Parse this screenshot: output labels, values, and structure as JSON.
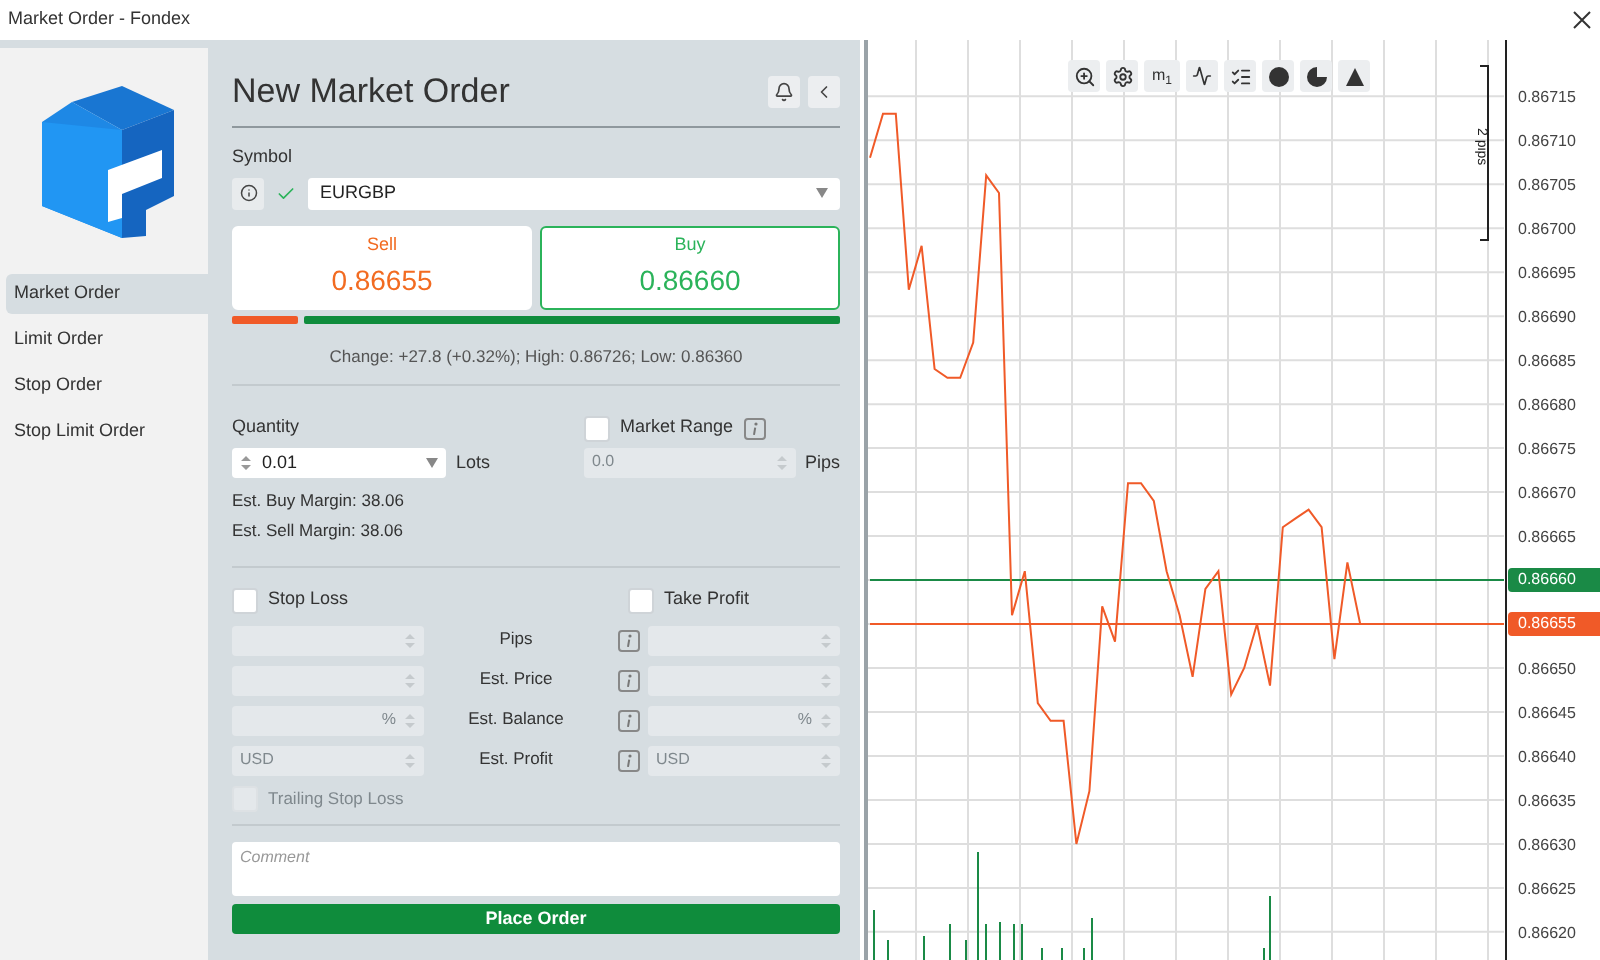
{
  "window": {
    "title": "Market Order - Fondex"
  },
  "sidebar": {
    "items": [
      {
        "label": "Market Order",
        "selected": true
      },
      {
        "label": "Limit Order",
        "selected": false
      },
      {
        "label": "Stop Order",
        "selected": false
      },
      {
        "label": "Stop Limit Order",
        "selected": false
      }
    ]
  },
  "form": {
    "title": "New Market Order",
    "symbol_label": "Symbol",
    "symbol_valid": true,
    "symbol": "EURGBP",
    "sell": {
      "label": "Sell",
      "price": "0.86655",
      "selected": false
    },
    "buy": {
      "label": "Buy",
      "price": "0.86660",
      "selected": true
    },
    "sentiment_bar": {
      "level": 0.11
    },
    "stats": "Change: +27.8 (+0.32%); High: 0.86726; Low: 0.86360",
    "quantity_label": "Quantity",
    "quantity": "0.01",
    "quantity_unit": "Lots",
    "margins": [
      "Est. Buy Margin: 38.06",
      "Est. Sell Margin: 38.06"
    ],
    "market_range": {
      "label": "Market Range",
      "checked": false,
      "placeholder": "0.0",
      "unit": "Pips",
      "disabled": true
    },
    "stop_loss": {
      "label": "Stop Loss",
      "checked": false
    },
    "take_profit": {
      "label": "Take Profit",
      "checked": false
    },
    "protection_rows": [
      {
        "label": "Pips",
        "sl": {},
        "tp": {}
      },
      {
        "label": "Est. Price",
        "sl": {},
        "tp": {}
      },
      {
        "label": "Est. Balance",
        "sl": {
          "unit": "%"
        },
        "tp": {
          "unit": "%"
        }
      },
      {
        "label": "Est. Profit",
        "sl": {
          "placeholder": "USD"
        },
        "tp": {
          "placeholder": "USD"
        }
      }
    ],
    "trailing_stop_loss": {
      "label": "Trailing Stop Loss",
      "checked": false,
      "disabled": true
    },
    "comment": {
      "placeholder": "Comment"
    },
    "place_order": "Place Order"
  },
  "chart": {
    "timeframe": "m$_{1}$",
    "range_label": "2 pips",
    "chart_data": {
      "type": "line",
      "grid": true,
      "ylim": [
        0.866168,
        0.867214
      ],
      "yticks": [
        {
          "value": 0.86715,
          "label": "0.86715"
        },
        {
          "value": 0.8671,
          "label": "0.86710"
        },
        {
          "value": 0.86705,
          "label": "0.86705"
        },
        {
          "value": 0.867,
          "label": "0.86700"
        },
        {
          "value": 0.86695,
          "label": "0.86695"
        },
        {
          "value": 0.8669,
          "label": "0.86690"
        },
        {
          "value": 0.86685,
          "label": "0.86685"
        },
        {
          "value": 0.8668,
          "label": "0.86680"
        },
        {
          "value": 0.86675,
          "label": "0.86675"
        },
        {
          "value": 0.8667,
          "label": "0.86670"
        },
        {
          "value": 0.86665,
          "label": "0.86665"
        },
        {
          "value": 0.8666,
          "label": "0.86660"
        },
        {
          "value": 0.86655,
          "label": "0.86655"
        },
        {
          "value": 0.8665,
          "label": "0.86650"
        },
        {
          "value": 0.86645,
          "label": "0.86645"
        },
        {
          "value": 0.8664,
          "label": "0.86640"
        },
        {
          "value": 0.86635,
          "label": "0.86635"
        },
        {
          "value": 0.8663,
          "label": "0.86630"
        },
        {
          "value": 0.86625,
          "label": "0.86625"
        },
        {
          "value": 0.8662,
          "label": "0.86620"
        }
      ],
      "series": [
        {
          "color": "#f05a28",
          "values": [
            0.86708,
            0.86713,
            0.86713,
            0.86693,
            0.86698,
            0.86684,
            0.86683,
            0.86683,
            0.86687,
            0.86706,
            0.86704,
            0.86656,
            0.86661,
            0.86646,
            0.86644,
            0.86644,
            0.8663,
            0.86636,
            0.86657,
            0.86653,
            0.86671,
            0.86671,
            0.86669,
            0.86661,
            0.86656,
            0.86649,
            0.86659,
            0.86661,
            0.86647,
            0.8665,
            0.86655,
            0.86648,
            0.86666,
            0.86667,
            0.86668,
            0.86666,
            0.86651,
            0.86662,
            0.86655,
            null,
            null,
            null,
            null,
            null,
            null,
            null,
            null,
            null,
            null,
            null
          ]
        },
        {
          "color": "#1a8a46",
          "values": [
            0.8666,
            0.8666,
            0.8666,
            0.8666,
            0.8666,
            0.8666,
            0.8666,
            0.8666,
            0.8666,
            0.8666,
            0.8666,
            0.8666,
            0.8666,
            0.8666,
            0.8666,
            0.8666,
            0.8666,
            0.8666,
            0.8666,
            0.8666,
            0.8666,
            0.8666,
            0.8666,
            0.8666,
            0.8666,
            0.8666,
            0.8666,
            0.8666,
            0.8666,
            0.8666,
            0.8666,
            0.8666,
            0.8666,
            0.8666,
            0.8666,
            0.8666,
            0.8666,
            0.8666,
            0.8666,
            0.8666,
            0.8666,
            0.8666,
            0.8666,
            0.8666,
            0.8666,
            0.8666,
            0.8666,
            0.8666,
            0.8666,
            0.8666
          ]
        },
        {
          "color": "#f05a28",
          "values": [
            0.86655,
            0.86655,
            0.86655,
            0.86655,
            0.86655,
            0.86655,
            0.86655,
            0.86655,
            0.86655,
            0.86655,
            0.86655,
            0.86655,
            0.86655,
            0.86655,
            0.86655,
            0.86655,
            0.86655,
            0.86655,
            0.86655,
            0.86655,
            0.86655,
            0.86655,
            0.86655,
            0.86655,
            0.86655,
            0.86655,
            0.86655,
            0.86655,
            0.86655,
            0.86655,
            0.86655,
            0.86655,
            0.86655,
            0.86655,
            0.86655,
            0.86655,
            0.86655,
            0.86655,
            0.86655,
            0.86655,
            0.86655,
            0.86655,
            0.86655,
            0.86655,
            0.86655,
            0.86655,
            0.86655,
            0.86655,
            0.86655,
            0.86655
          ]
        }
      ]
    }
  }
}
